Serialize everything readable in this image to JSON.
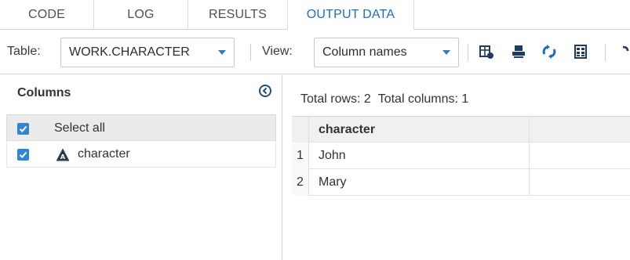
{
  "tabs": [
    {
      "label": "CODE",
      "active": false
    },
    {
      "label": "LOG",
      "active": false
    },
    {
      "label": "RESULTS",
      "active": false
    },
    {
      "label": "OUTPUT DATA",
      "active": true
    }
  ],
  "toolbar": {
    "table_label": "Table:",
    "table_value": "WORK.CHARACTER",
    "view_label": "View:",
    "view_value": "Column names",
    "icons": [
      "data-properties-icon",
      "print-icon",
      "refresh-icon",
      "grid-options-icon"
    ]
  },
  "columns_panel": {
    "title": "Columns",
    "select_all_label": "Select all",
    "select_all_checked": true,
    "items": [
      {
        "label": "character",
        "type_icon": "character-type-icon",
        "checked": true
      }
    ]
  },
  "data_view": {
    "total_rows_label": "Total rows: 2",
    "total_columns_label": "Total columns: 1",
    "column_header": "character",
    "rows": [
      {
        "num": "1",
        "value": "John"
      },
      {
        "num": "2",
        "value": "Mary"
      }
    ]
  },
  "colors": {
    "accent": "#1b6fb5",
    "checkbox": "#2f86d6",
    "type_icon": "#2a3a55"
  }
}
